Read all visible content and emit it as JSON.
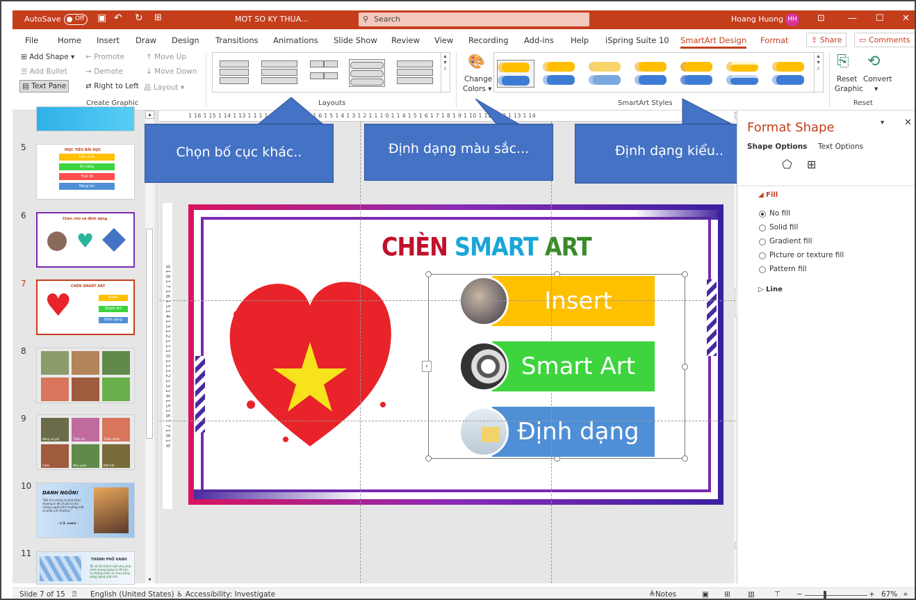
{
  "titlebar": {
    "autosave": "AutoSave",
    "toggle": "Off",
    "filename": "MOT SO KY THUA...",
    "search": "Search",
    "user": "Hoang Huong",
    "initials": "HH"
  },
  "menu": [
    "File",
    "Home",
    "Insert",
    "Draw",
    "Design",
    "Transitions",
    "Animations",
    "Slide Show",
    "Review",
    "View",
    "Recording",
    "Add-ins",
    "Help",
    "iSpring Suite 10",
    "SmartArt Design",
    "Format"
  ],
  "menu_right": {
    "share": "Share",
    "comments": "Comments"
  },
  "ribbon": {
    "create": {
      "add_shape": "Add Shape",
      "promote": "Promote",
      "move_up": "Move Up",
      "add_bullet": "Add Bullet",
      "demote": "Demote",
      "move_down": "Move Down",
      "text_pane": "Text Pane",
      "rtl": "Right to Left",
      "layout": "Layout",
      "group": "Create Graphic"
    },
    "layouts_group": "Layouts",
    "change_colors": "Change",
    "change_colors2": "Colors",
    "styles_group": "SmartArt Styles",
    "reset_graphic": "Reset",
    "reset_graphic2": "Graphic",
    "convert": "Convert",
    "reset_group": "Reset"
  },
  "ruler_h": "1 16 1 15 1 14 1 13 1   1   1   1 10 1 9 1 8 1 7 1 6 1 5 1 4 1 3 1 2 1 1 1 0 1     1 4 1 5 1 6 1 7 1 8 1 9 1 10 1 11 1 12 1 13 1 14",
  "ruler_v": "9 1 8 1 7 1 6 1 5 1 4 1 3 1 2 1 1 1 0 1 1 1 2 1 3 1 4 1 5 1 6 1 7 1 8 1 9",
  "thumbs": [
    {
      "num": "5",
      "title": "MỤC TIÊU BÀI HỌC",
      "items": [
        "Kiến thức",
        "Kỹ năng",
        "Thái độ",
        "Năng lực"
      ]
    },
    {
      "num": "6",
      "title": "Chèn chữ và định dạng"
    },
    {
      "num": "7",
      "title": "CHÈN SMART ART",
      "items": [
        "Insert",
        "Smart Art",
        "Định dạng"
      ]
    },
    {
      "num": "8"
    },
    {
      "num": "9",
      "caps": [
        "Nắng và gió",
        "Thiên tại",
        "Thiên nhiên",
        "Vườn",
        "Mùa xuân",
        "Mặt trời"
      ]
    },
    {
      "num": "10",
      "title": "DANH NGÔN!",
      "quote": "\"Đôi khi những sự khó khăn thương là để chuẩn bị cho những người bình thường một số phận phi thường.\"",
      "author": "– C.S. Lewis –"
    },
    {
      "num": "11",
      "title": "THÀNH PHỐ XANH",
      "body": "Tôi sẽ trở thành một nhà phát minh trong tương lai để làm ra những chiếc xe chạy bằng năng lượng mặt trời."
    }
  ],
  "callouts": {
    "layout": "Chọn bố cục khác..",
    "colors": "Định dạng màu sắc...",
    "styles": "Định dạng kiểu.."
  },
  "slide": {
    "title_a": "CHÈN",
    "title_b": "SMART",
    "title_c": "ART",
    "items": [
      "Insert",
      "Smart Art",
      "Định dạng"
    ]
  },
  "colors": {
    "accent": "#c43e1c",
    "insert": "#ffc000",
    "smartart": "#3ed43e",
    "dinhdang": "#4f8fd6",
    "heart": "#e8232a",
    "star": "#f7e31b"
  },
  "format_pane": {
    "title": "Format Shape",
    "tab1": "Shape Options",
    "tab2": "Text Options",
    "fill": "Fill",
    "options": [
      "No fill",
      "Solid fill",
      "Gradient fill",
      "Picture or texture fill",
      "Pattern fill"
    ],
    "selected": "No fill",
    "line": "Line"
  },
  "status": {
    "slide": "Slide 7 of 15",
    "lang": "English (United States)",
    "access": "Accessibility: Investigate",
    "notes": "Notes",
    "zoom": "67%"
  }
}
